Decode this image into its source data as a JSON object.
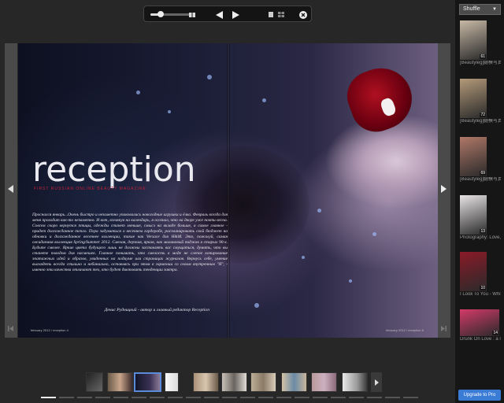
{
  "toolbar": {
    "zoom_level": 0.25,
    "icons": [
      "zoom-slider",
      "single-page-view-icon",
      "previous-icon",
      "play-icon",
      "page-icon",
      "grid-icon",
      "close-icon"
    ]
  },
  "magazine": {
    "title": "reception",
    "subtitle": "FIRST RUSSIAN ONLINE BEAUTY MAGAZINE",
    "body": "Проснался январь...Очень быстро и незаметно упаковались новогодние игрушки и ёлка. Февраль всегда для меня проходит как-то незаметно. И вот, взглянув на календарь, я осознал, что на дворе уже почти весна. Совсем скоро вернутся птицы, одежды станет меньше, смысл на вкладе больше, а самое главное - придет долгожданное тепло. Пора задуматься о весеннем гардеробе, распланировать свой бюджет на обновки и долгожданное весеннее коллекции, такие как Versace для H&M. Это, пожалуй, самая ожидаемая коллекция Spring/Summer 2012. Смелая, дерзкая, яркая, как малиновый пиджак в старых 90-х. Будьте смелее. Яркие цвета будущего лишь не должны заставлять вас смущаться, думать, что вы станете поводом для насмешек. Главное понимать, что смелость в моде не слепое копирование эпатажных идей и образов, увиденных на подиуме или страницах журналов. Вернусь себе, умение выглядеть всегда стильно и небанально, оставаясь при этом в гармонии со своим внутренним \"Я\", - именно эти качества отличают тех, кто будет диктовать тенденции завтра.",
    "signature": "Денис Рудницкий - автор и главный редактор Reception",
    "folio_left": "february 2012 / reception 4",
    "folio_right": "february 2012 / reception 5"
  },
  "sidebar": {
    "shuffle_label": "Shuffle",
    "items": [
      {
        "count": "61",
        "label": "[Beautyleg]腿模写真 No.237 Sara 🍭",
        "color": "#c8b9a6"
      },
      {
        "count": "72",
        "label": "[Beautyleg]腿模写真 No.267 Sara 🍭",
        "color": "#b49a7a"
      },
      {
        "count": "69",
        "label": "[Beautyleg]腿模写真 No.267 Sara 🍭",
        "color": "#b07868"
      },
      {
        "count": "13",
        "label": "Photography: Love, Hate & Regrets",
        "color": "#e8e4e6"
      },
      {
        "count": "10",
        "label": "I Look To You - Whitney Tribute",
        "color": "#8a1a28"
      },
      {
        "count": "14",
        "label": "Drunk On Love : a shooting by",
        "color": "#d43a6a"
      }
    ],
    "upgrade_label": "Upgrade to Pro"
  }
}
